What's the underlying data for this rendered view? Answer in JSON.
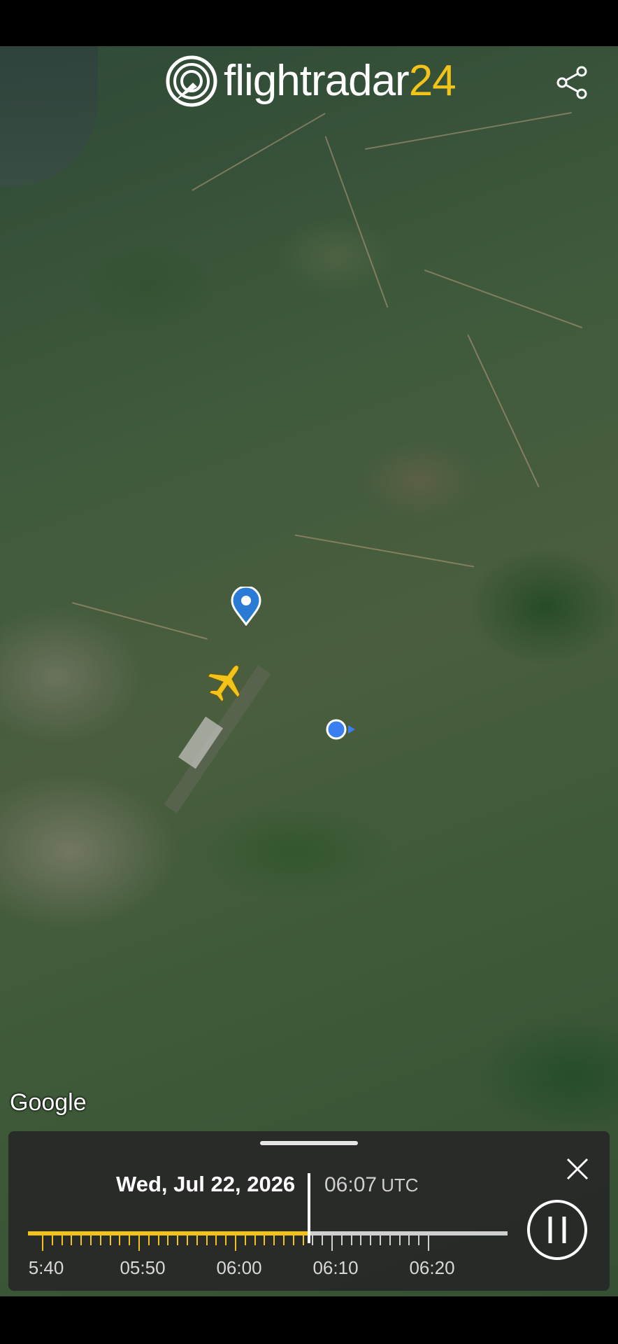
{
  "app": {
    "name_main": "flightradar",
    "name_num": "24",
    "brand_yellow": "#f2c318"
  },
  "icons": {
    "logo": "flightradar24-radar-logo",
    "share": "share-icon",
    "pin": "airport-pin-icon",
    "plane": "airplane-icon",
    "location": "current-location-icon",
    "close": "close-icon",
    "pause": "pause-icon"
  },
  "map": {
    "attribution": "Google"
  },
  "playback": {
    "date": "Wed, Jul 22, 2026",
    "time": "06:07",
    "timezone": "UTC",
    "ticks": [
      "5:40",
      "05:50",
      "06:00",
      "06:10",
      "06:20"
    ],
    "progress_fraction": 0.6
  }
}
